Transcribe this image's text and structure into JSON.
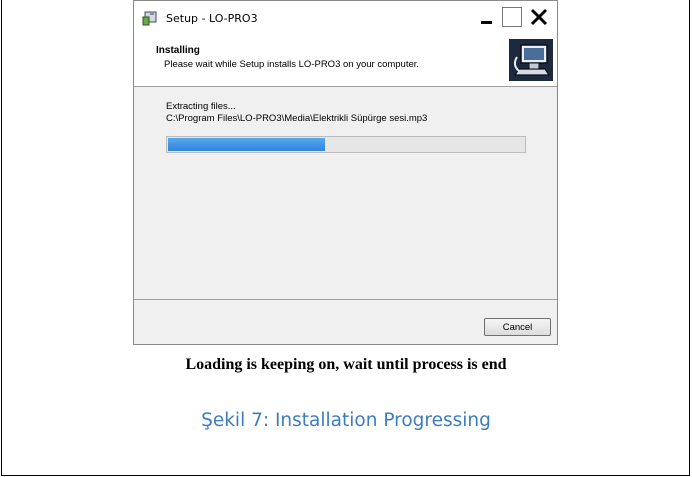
{
  "window": {
    "title": "Setup - LO-PRO3",
    "icon": "setup-installer-icon"
  },
  "header": {
    "title": "Installing",
    "subtitle": "Please wait while Setup installs LO-PRO3 on your computer.",
    "image": "computer-install-icon"
  },
  "body": {
    "status": "Extracting files...",
    "file_path": "C:\\Program Files\\LO-PRO3\\Media\\Elektrikli Süpürge sesi.mp3",
    "progress": 0.44,
    "progress_color": "#3b8fe0"
  },
  "footer": {
    "cancel_label": "Cancel"
  },
  "captions": {
    "note": "Loading is keeping on, wait until process is end",
    "figure": "Şekil 7: Installation Progressing",
    "figure_color": "#3d7cc0"
  }
}
